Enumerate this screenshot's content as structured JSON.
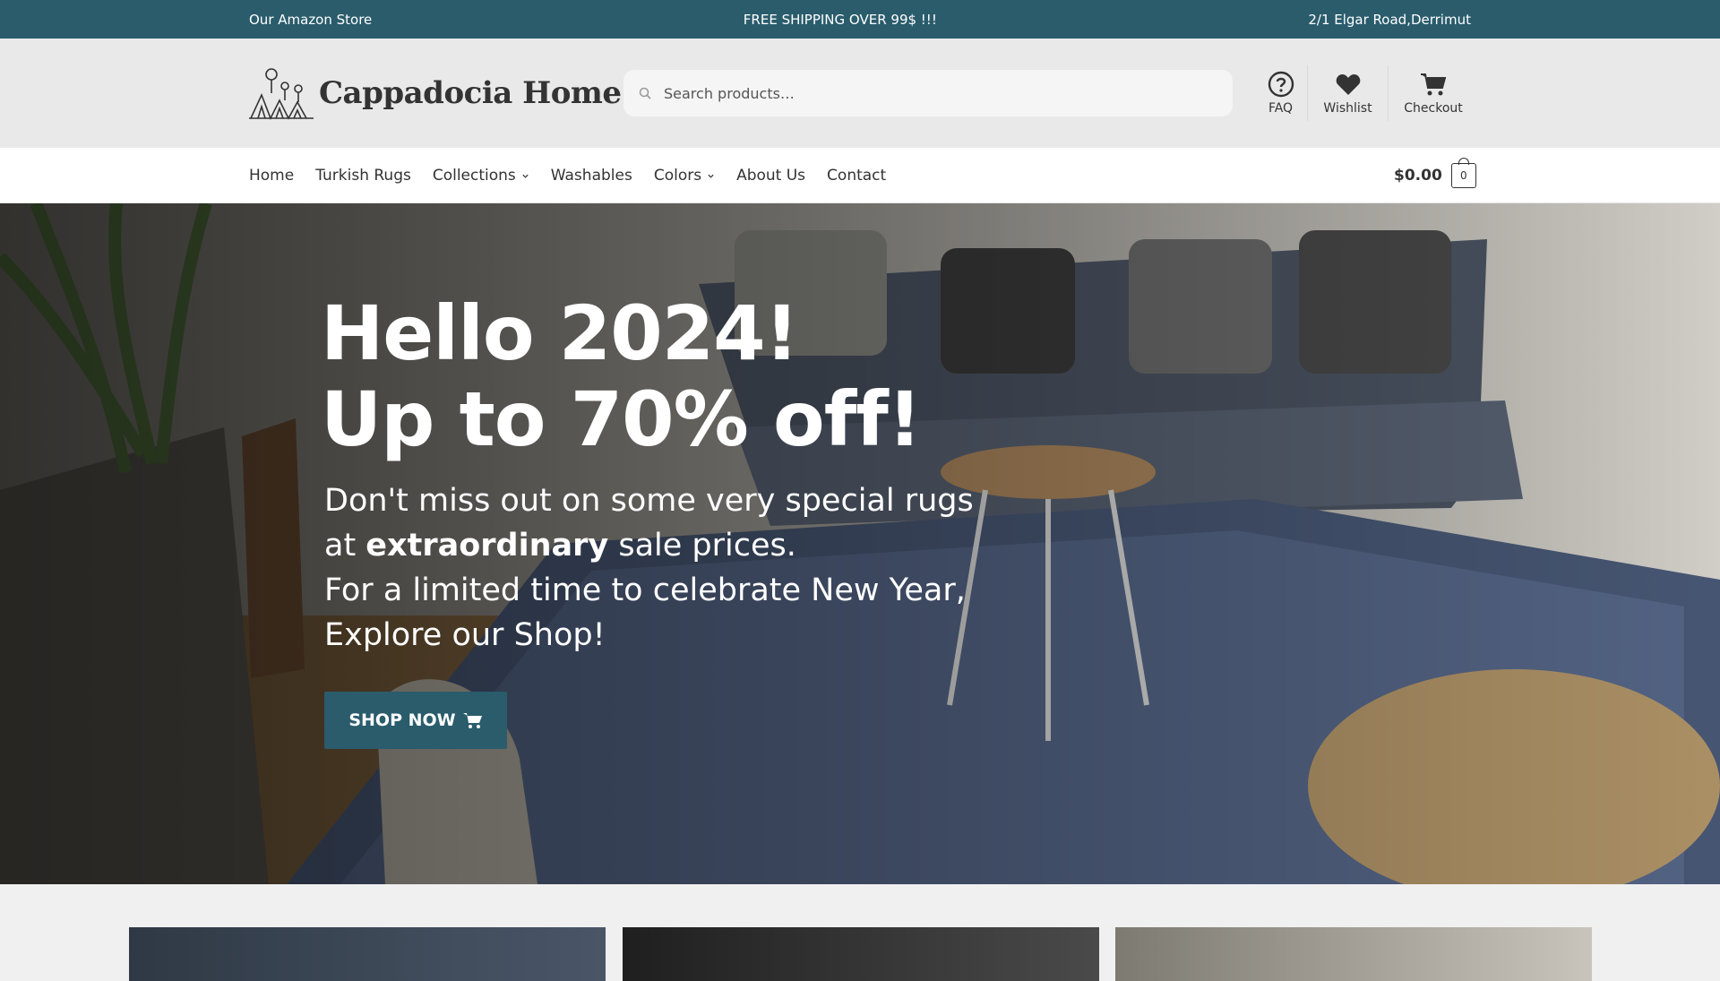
{
  "topbar": {
    "left": "Our Amazon Store",
    "center": "FREE SHIPPING OVER 99$ !!!",
    "right": "2/1 Elgar Road,Derrimut"
  },
  "header": {
    "logo_text": "Cappadocia Home",
    "search": {
      "placeholder": "Search products…",
      "icon": "search-icon"
    },
    "icons": [
      {
        "label": "FAQ",
        "icon": "question-circle-icon"
      },
      {
        "label": "Wishlist",
        "icon": "heart-icon"
      },
      {
        "label": "Checkout",
        "icon": "cart-icon"
      }
    ]
  },
  "nav": {
    "items": [
      {
        "label": "Home"
      },
      {
        "label": "Turkish Rugs"
      },
      {
        "label": "Collections",
        "dropdown": true
      },
      {
        "label": "Washables"
      },
      {
        "label": "Colors",
        "dropdown": true
      },
      {
        "label": "About Us"
      },
      {
        "label": "Contact"
      }
    ],
    "cart": {
      "amount": "$0.00",
      "count": "0"
    }
  },
  "hero": {
    "title_line1": "Hello 2024!",
    "title_line2": "Up to 70% off!",
    "sub_line1": "Don't miss out on some very special rugs",
    "sub_line2_pre": "at ",
    "sub_line2_bold": "extraordinary",
    "sub_line2_post": " sale prices.",
    "sub_line3": "For a limited time to celebrate New Year,",
    "sub_line4": "Explore our Shop!",
    "button": "SHOP NOW"
  },
  "colors": {
    "brand": "#2a5c6c",
    "header_bg": "#e9e9e9",
    "nav_bg": "#ffffff"
  }
}
